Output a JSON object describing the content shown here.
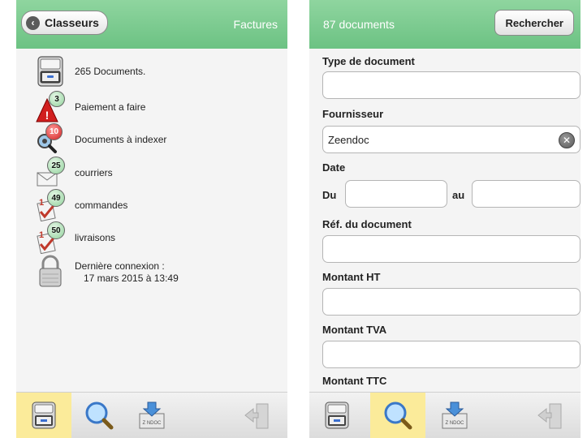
{
  "left": {
    "back_label": "Classeurs",
    "title": "Factures",
    "items": [
      {
        "label": "265 Documents.",
        "icon": "drawer-icon"
      },
      {
        "label": "Paiement a faire",
        "badge": "3",
        "icon": "warning-icon"
      },
      {
        "label": "Documents à indexer",
        "badge": "10",
        "icon": "magnifier-gear-icon"
      },
      {
        "label": "courriers",
        "badge": "25",
        "icon": "envelope-icon"
      },
      {
        "label": "commandes",
        "badge": "49",
        "icon": "order-icon"
      },
      {
        "label": "livraisons",
        "badge": "50",
        "icon": "delivery-icon"
      }
    ],
    "last_login_label": "Dernière connexion :",
    "last_login_value": "17 mars 2015 à 13:49"
  },
  "right": {
    "count_title": "87 documents",
    "search_label": "Rechercher",
    "fields": {
      "type": {
        "label": "Type de document",
        "value": ""
      },
      "fournisseur": {
        "label": "Fournisseur",
        "value": "Zeendoc"
      },
      "date": {
        "label": "Date",
        "from_label": "Du",
        "to_label": "au"
      },
      "ref": {
        "label": "Réf. du document",
        "value": ""
      },
      "ht": {
        "label": "Montant HT",
        "value": ""
      },
      "tva": {
        "label": "Montant TVA",
        "value": ""
      },
      "ttc": {
        "label": "Montant TTC"
      }
    }
  },
  "tabbar": {
    "tabs": [
      "drawer-icon",
      "search-icon",
      "zeendoc-icon",
      "logout-icon"
    ],
    "zeendoc_text": "Z NDOC"
  },
  "colors": {
    "header_green": "#6cc283",
    "active_tab": "#fbeb9a",
    "badge_red": "#d02020",
    "badge_green": "#8fd19a"
  }
}
